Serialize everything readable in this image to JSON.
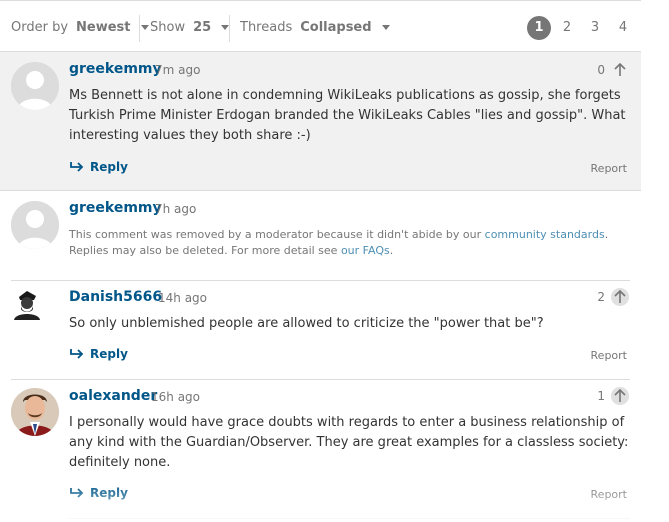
{
  "toolbar": {
    "order_label": "Order by",
    "order_value": "Newest",
    "show_label": "Show",
    "show_value": "25",
    "threads_label": "Threads",
    "threads_value": "Collapsed",
    "pages": [
      "1",
      "2",
      "3",
      "4"
    ],
    "current_page": "1"
  },
  "comments": [
    {
      "username": "greekemmy",
      "timestamp": "7m ago",
      "body": "Ms Bennett is not alone in condemning WikiLeaks publications as gossip, she forgets Turkish Prime Minister Erdogan branded the WikiLeaks Cables \"lies and gossip\". What interesting values they both share :-)",
      "votes": "0",
      "reply_label": "Reply",
      "report_label": "Report"
    },
    {
      "username": "greekemmy",
      "timestamp": "7h ago",
      "removed_text_1": "This comment was removed by a moderator because it didn't abide by our ",
      "removed_link_1": "community standards",
      "removed_text_2": ". Replies may also be deleted. For more detail see ",
      "removed_link_2": "our FAQs",
      "removed_text_3": "."
    },
    {
      "username": "Danish5666",
      "timestamp": "14h ago",
      "body": "So only unblemished people are allowed to criticize the \"power that be\"?",
      "votes": "2",
      "reply_label": "Reply",
      "report_label": "Report"
    },
    {
      "username": "oalexander",
      "timestamp": "16h ago",
      "body": "I personally would have grace doubts with regards to enter a business relationship of any kind with the Guardian/Observer. They are great examples for a classless society: definitely none.",
      "votes": "1",
      "reply_label": "Reply",
      "report_label": "Report"
    }
  ]
}
